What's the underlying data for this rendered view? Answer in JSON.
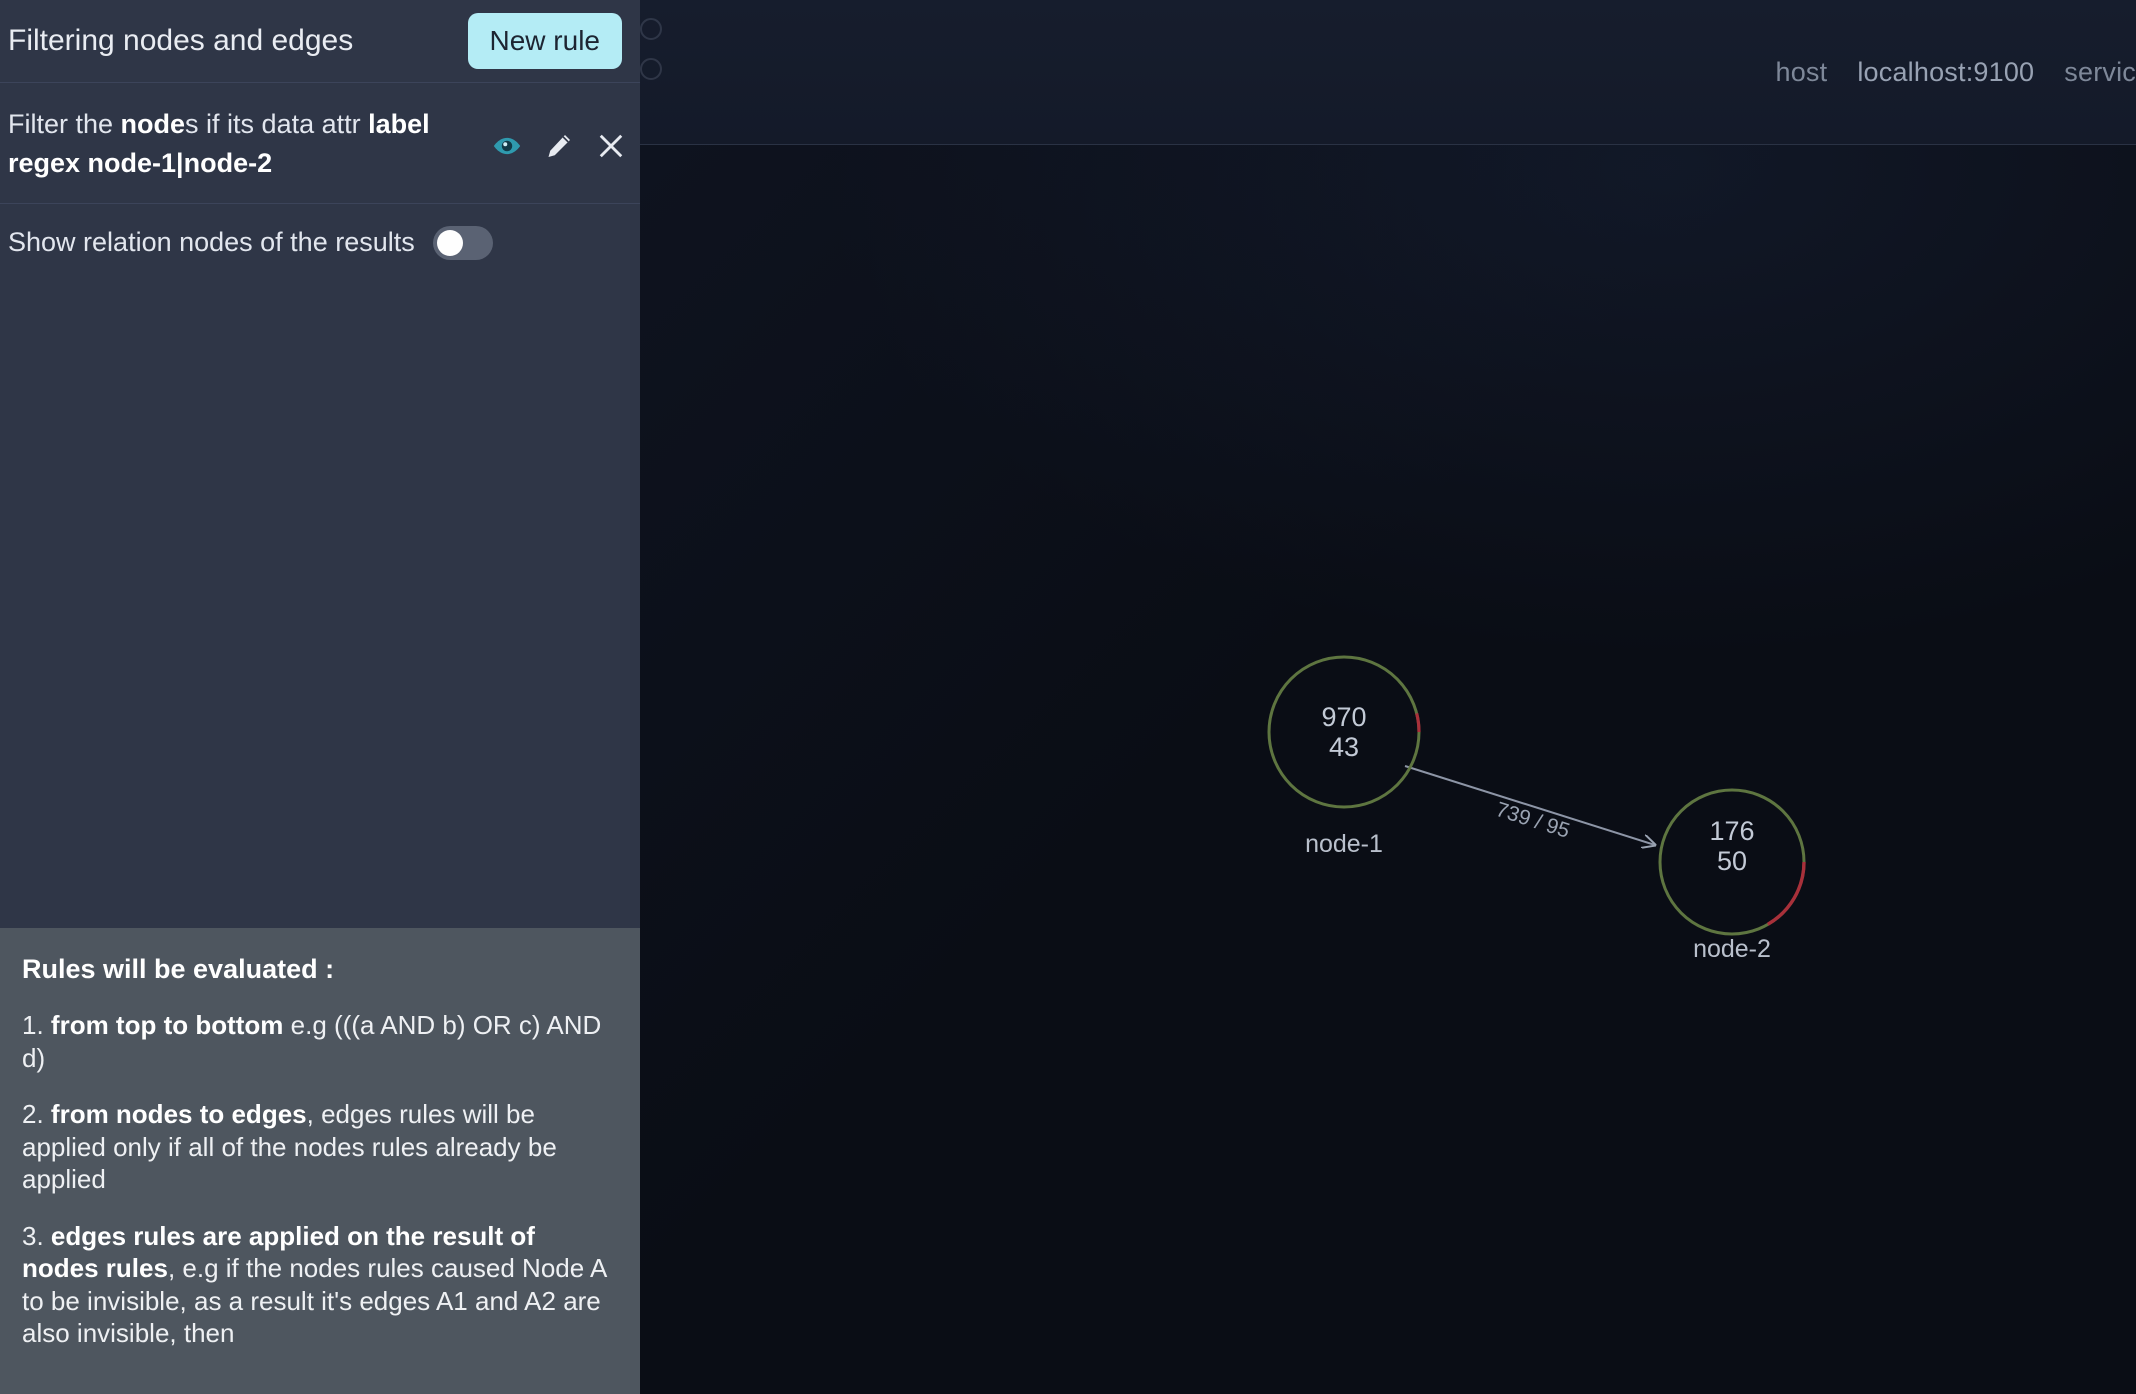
{
  "sidebar": {
    "title": "Filtering nodes and edges",
    "new_rule_label": "New rule",
    "rule": {
      "prefix": "Filter the ",
      "subject": "node",
      "mid": "s if its data attr ",
      "attr": "label",
      "op_value": "regex node-1|node-2",
      "actions": {
        "visibility": "eye-icon",
        "edit": "pencil-icon",
        "delete": "close-icon"
      }
    },
    "toggle": {
      "label": "Show relation nodes of the results",
      "state": "off"
    },
    "rules_info": {
      "heading": "Rules will be evaluated :",
      "item1_num": "1. ",
      "item1_bold": "from top to bottom",
      "item1_rest": " e.g (((a AND b) OR c) AND d)",
      "item2_num": "2. ",
      "item2_bold": "from nodes to edges",
      "item2_rest": ", edges rules will be applied only if all of the nodes rules already be applied",
      "item3_num": "3. ",
      "item3_bold": "edges rules are applied on the result of nodes rules",
      "item3_rest": ", e.g if the nodes rules caused Node A to be invisible, as a result it's edges A1 and A2 are also invisible, then"
    }
  },
  "canvas_header": {
    "host_label": "host",
    "host_value": "localhost:9100",
    "service_label": "servic"
  },
  "graph": {
    "nodes": [
      {
        "id": "node-1",
        "label": "node-1",
        "metric_top": "970",
        "metric_bottom": "43",
        "ring_ok_color": "#5e7540",
        "ring_alert_color": "#a8303a",
        "alert_fraction": 0.06
      },
      {
        "id": "node-2",
        "label": "node-2",
        "metric_top": "176",
        "metric_bottom": "50",
        "ring_ok_color": "#5e7540",
        "ring_alert_color": "#a8303a",
        "alert_fraction": 0.21
      }
    ],
    "edges": [
      {
        "from": "node-1",
        "to": "node-2",
        "label": "739 / 95"
      }
    ]
  },
  "colors": {
    "accent": "#b4ecf5",
    "sidebar_bg": "#2f3647",
    "info_bg": "#4e565f",
    "canvas_bg": "#0a0d15",
    "eye_icon": "#2f9aae"
  }
}
